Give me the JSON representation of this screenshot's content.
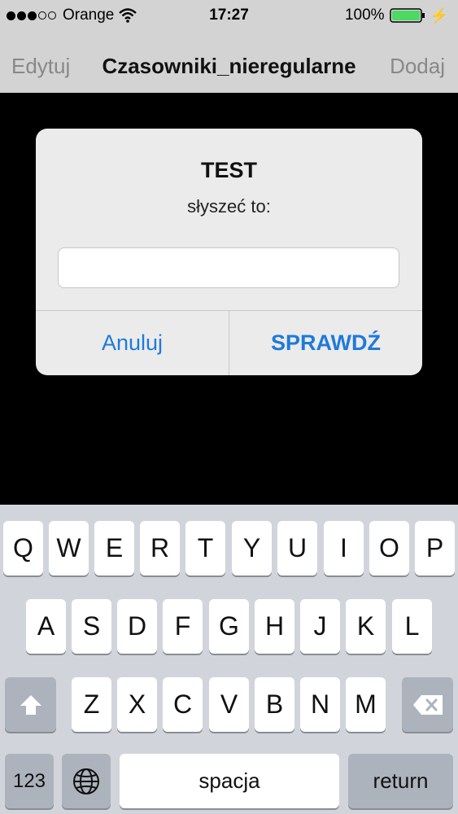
{
  "status_bar": {
    "carrier": "Orange",
    "time": "17:27",
    "battery_percent": "100%",
    "battery_level": 1.0,
    "signal_bars_filled": 3,
    "signal_bars_total": 5
  },
  "nav_bar": {
    "left_label": "Edytuj",
    "title": "Czasowniki_nieregularne",
    "right_label": "Dodaj"
  },
  "alert": {
    "title": "TEST",
    "message": "słyszeć to:",
    "input_value": "",
    "cancel_label": "Anuluj",
    "confirm_label": "SPRAWDŹ",
    "button_color": "#1f7ad9"
  },
  "keyboard": {
    "row1": [
      "Q",
      "W",
      "E",
      "R",
      "T",
      "Y",
      "U",
      "I",
      "O",
      "P"
    ],
    "row2": [
      "A",
      "S",
      "D",
      "F",
      "G",
      "H",
      "J",
      "K",
      "L"
    ],
    "row3": [
      "Z",
      "X",
      "C",
      "V",
      "B",
      "N",
      "M"
    ],
    "numbers_label": "123",
    "space_label": "spacja",
    "return_label": "return"
  }
}
